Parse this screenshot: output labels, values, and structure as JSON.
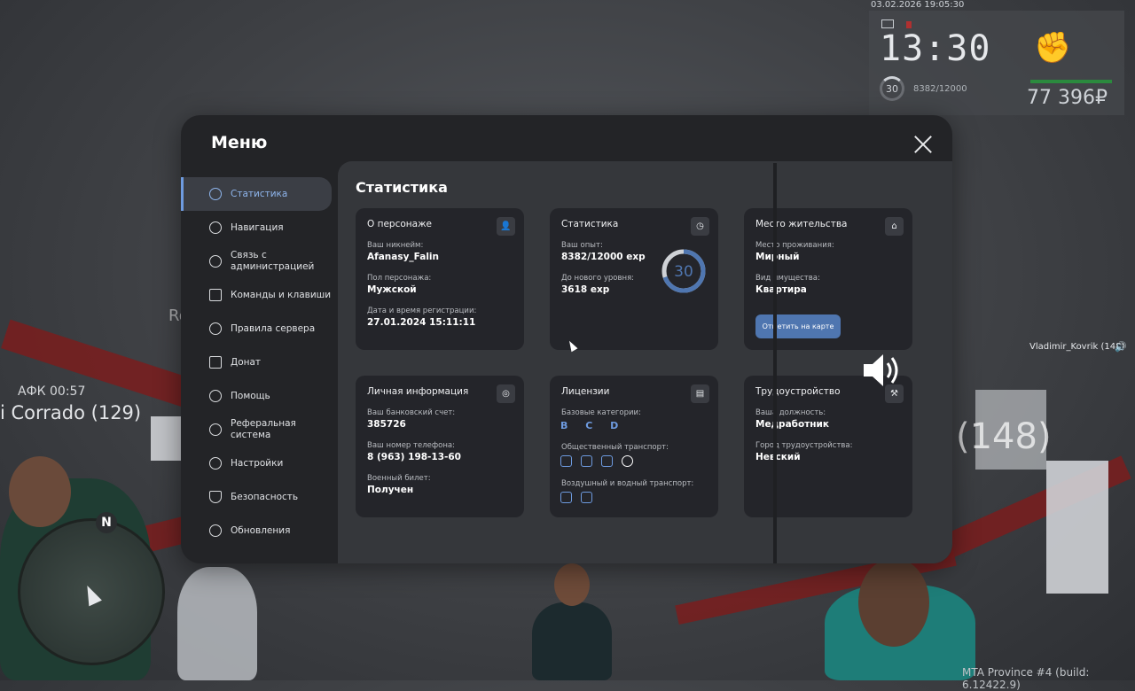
{
  "hud": {
    "datetime": "03.02.2026 19:05:30",
    "time": "13:30",
    "level": "30",
    "exp": "8382/12000",
    "money": "77 396₽",
    "health_fraction": 1.0
  },
  "world": {
    "afk_text": "АФК 00:57",
    "nick_corrado": "i Corrado (129)",
    "nick_148": "(148)",
    "nick_kovrik": "Vladimir_Kovrik (148)",
    "ro_tag": "Ro",
    "build_info": "MTA Province #4 (build: 6.12422.9)",
    "compass_north": "N"
  },
  "menu": {
    "title": "Меню",
    "sidebar": [
      {
        "label": "Статистика",
        "icon": "pie-chart-icon"
      },
      {
        "label": "Навигация",
        "icon": "compass-icon"
      },
      {
        "label": "Связь с администрацией",
        "icon": "headset-icon"
      },
      {
        "label": "Команды и клавиши",
        "icon": "keyboard-icon"
      },
      {
        "label": "Правила сервера",
        "icon": "scales-icon"
      },
      {
        "label": "Донат",
        "icon": "wallet-icon"
      },
      {
        "label": "Помощь",
        "icon": "handshake-icon"
      },
      {
        "label": "Реферальная система",
        "icon": "people-network-icon"
      },
      {
        "label": "Настройки",
        "icon": "gear-icon"
      },
      {
        "label": "Безопасность",
        "icon": "shield-icon"
      },
      {
        "label": "Обновления",
        "icon": "check-circle-icon"
      }
    ],
    "active_index": 0,
    "content_title": "Статистика",
    "accent_color": "#6e9be0"
  },
  "cards": {
    "character": {
      "title": "О персонаже",
      "nickname_label": "Ваш никнейм:",
      "nickname": "Afanasy_Falin",
      "gender_label": "Пол персонажа:",
      "gender": "Мужской",
      "reg_label": "Дата и время регистрации:",
      "reg": "27.01.2024 15:11:11"
    },
    "stats": {
      "title": "Статистика",
      "exp_label": "Ваш опыт:",
      "exp": "8382/12000 exp",
      "next_label": "До нового уровня:",
      "next": "3618 exp",
      "level": "30",
      "progress": 0.6985
    },
    "residence": {
      "title": "Место жительства",
      "place_label": "Место проживания:",
      "place": "Мирный",
      "property_label": "Вид имущества:",
      "property": "Квартира",
      "button": "Отметить на карте"
    },
    "personal": {
      "title": "Личная информация",
      "bank_label": "Ваш банковский счет:",
      "bank": "385726",
      "phone_label": "Ваш номер телефона:",
      "phone": "8 (963) 198-13-60",
      "military_label": "Военный билет:",
      "military": "Получен"
    },
    "licenses": {
      "title": "Лицензии",
      "base_label": "Базовые категории:",
      "base": "B C D",
      "public_label": "Общественный транспорт:",
      "air_label": "Воздушный и водный транспорт:"
    },
    "job": {
      "title": "Трудоустройство",
      "position_label": "Ваша должность:",
      "position": "Медработник",
      "city_label": "Город трудоустройства:",
      "city": "Невский"
    }
  }
}
